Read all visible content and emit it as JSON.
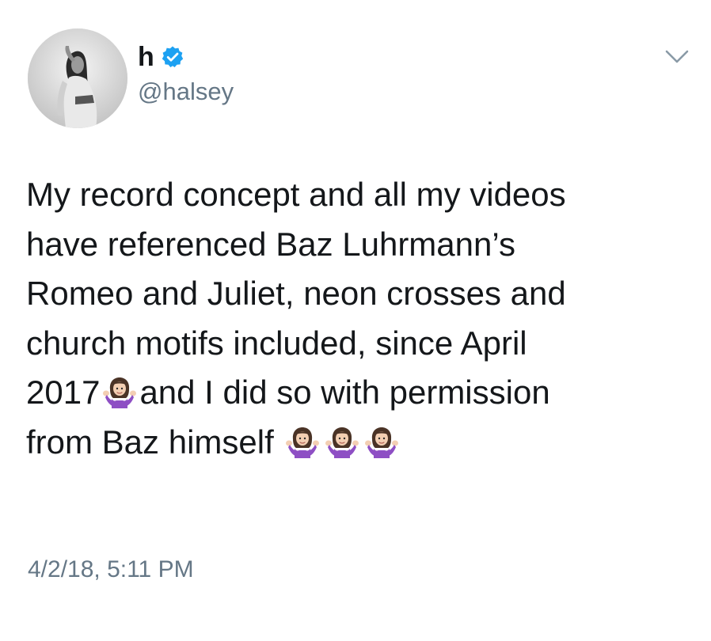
{
  "tweet": {
    "display_name": "h",
    "handle": "@halsey",
    "text_lines": [
      "My record concept and all my videos",
      "have referenced Baz Luhrmann’s",
      "Romeo and Juliet, neon crosses and",
      "church motifs included, since April"
    ],
    "line5_before": "2017",
    "line5_after": "and I did so with permission",
    "line6_text": "from Baz himself",
    "emoji": "woman-shrugging-emoji",
    "timestamp": "4/2/18, 5:11 PM",
    "colors": {
      "text": "#14171a",
      "secondary": "#657786",
      "verified": "#1da1f2",
      "emoji_shirt": "#8e4fc4"
    }
  }
}
